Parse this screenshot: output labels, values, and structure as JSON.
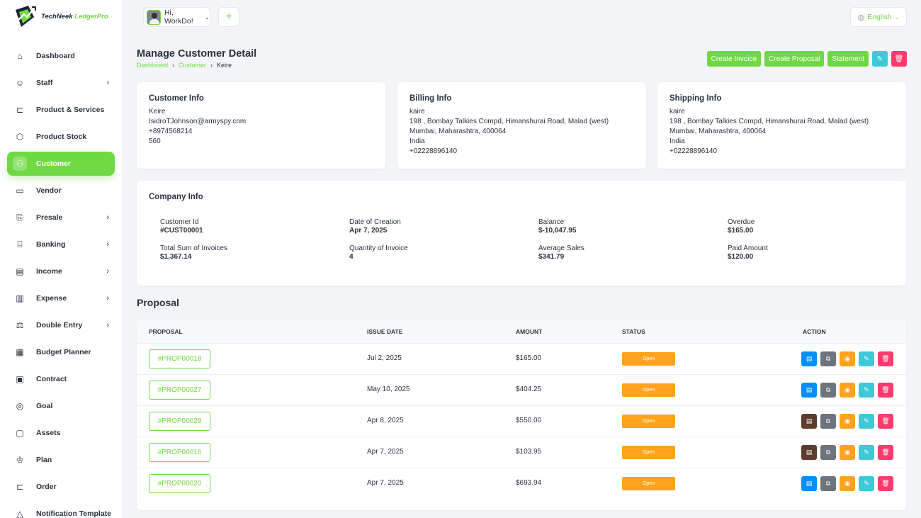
{
  "brand": {
    "name": "TechNeek",
    "accent": "LedgerPro",
    "accent_color": "#6fd943"
  },
  "sidebar": {
    "items": [
      {
        "label": "Dashboard",
        "icon": "home-icon",
        "glyph": "⌂",
        "chevron": false,
        "active": false
      },
      {
        "label": "Staff",
        "icon": "users-icon",
        "glyph": "☺",
        "chevron": true,
        "active": false
      },
      {
        "label": "Product & Services",
        "icon": "cart-icon",
        "glyph": "⊏",
        "chevron": false,
        "active": false
      },
      {
        "label": "Product Stock",
        "icon": "box-icon",
        "glyph": "⬡",
        "chevron": false,
        "active": false
      },
      {
        "label": "Customer",
        "icon": "user-plus-icon",
        "glyph": "⚇",
        "chevron": false,
        "active": true
      },
      {
        "label": "Vendor",
        "icon": "note-icon",
        "glyph": "▭",
        "chevron": false,
        "active": false
      },
      {
        "label": "Presale",
        "icon": "file-icon",
        "glyph": "⎘",
        "chevron": true,
        "active": false
      },
      {
        "label": "Banking",
        "icon": "bank-icon",
        "glyph": "⌸",
        "chevron": true,
        "active": false
      },
      {
        "label": "Income",
        "icon": "invoice-icon",
        "glyph": "▤",
        "chevron": true,
        "active": false
      },
      {
        "label": "Expense",
        "icon": "receipt-icon",
        "glyph": "▥",
        "chevron": true,
        "active": false
      },
      {
        "label": "Double Entry",
        "icon": "scale-icon",
        "glyph": "⚖",
        "chevron": true,
        "active": false
      },
      {
        "label": "Budget Planner",
        "icon": "budget-icon",
        "glyph": "▦",
        "chevron": false,
        "active": false
      },
      {
        "label": "Contract",
        "icon": "contract-icon",
        "glyph": "▣",
        "chevron": false,
        "active": false
      },
      {
        "label": "Goal",
        "icon": "target-icon",
        "glyph": "◎",
        "chevron": false,
        "active": false
      },
      {
        "label": "Assets",
        "icon": "calendar-icon",
        "glyph": "▢",
        "chevron": false,
        "active": false
      },
      {
        "label": "Plan",
        "icon": "trophy-icon",
        "glyph": "♔",
        "chevron": false,
        "active": false
      },
      {
        "label": "Order",
        "icon": "order-icon",
        "glyph": "⊏",
        "chevron": false,
        "active": false
      },
      {
        "label": "Notification Template",
        "icon": "bell-icon",
        "glyph": "△",
        "chevron": false,
        "active": false
      }
    ]
  },
  "header": {
    "greeting": "Hi, WorkDo!",
    "language": "English"
  },
  "page": {
    "title": "Manage Customer Detail",
    "breadcrumb": [
      "Dashboard",
      "Customer",
      "Keire"
    ],
    "actions": {
      "create_invoice": "Create Invoice",
      "create_proposal": "Create Proposal",
      "statement": "Statement"
    }
  },
  "customer_info": {
    "title": "Customer Info",
    "lines": [
      "Keire",
      "IsidroTJohnson@armyspy.com",
      "+8974568214",
      "560"
    ]
  },
  "billing_info": {
    "title": "Billing Info",
    "lines": [
      "kaire",
      "198 , Bombay Talkies Compd, Himanshurai Road, Malad (west)",
      "Mumbai, Maharashtra, 400064",
      "India",
      "+02228896140"
    ]
  },
  "shipping_info": {
    "title": "Shipping Info",
    "lines": [
      "kaire",
      "198 , Bombay Talkies Compd, Himanshurai Road, Malad (west)",
      "Mumbai, Maharashtra, 400064",
      "India",
      "+02228896140"
    ]
  },
  "company_info": {
    "title": "Company Info",
    "items": [
      {
        "label": "Customer Id",
        "value": "#CUST00001"
      },
      {
        "label": "Date of Creation",
        "value": "Apr 7, 2025"
      },
      {
        "label": "Balance",
        "value": "$-10,047.95"
      },
      {
        "label": "Overdue",
        "value": "$165.00"
      },
      {
        "label": "Total Sum of Invoices",
        "value": "$1,367.14"
      },
      {
        "label": "Quantity of Invoice",
        "value": "4"
      },
      {
        "label": "Average Sales",
        "value": "$341.79"
      },
      {
        "label": "Paid Amount",
        "value": "$120.00"
      }
    ]
  },
  "proposal": {
    "title": "Proposal",
    "columns": [
      "PROPOSAL",
      "ISSUE DATE",
      "AMOUNT",
      "STATUS",
      "ACTION"
    ],
    "rows": [
      {
        "id": "#PROP00018",
        "date": "Jul 2, 2025",
        "amount": "$165.00",
        "status": "Open",
        "first_action": "blue"
      },
      {
        "id": "#PROP00027",
        "date": "May 10, 2025",
        "amount": "$404.25",
        "status": "Open",
        "first_action": "blue"
      },
      {
        "id": "#PROP00028",
        "date": "Apr 8, 2025",
        "amount": "$550.00",
        "status": "Open",
        "first_action": "brown"
      },
      {
        "id": "#PROP00016",
        "date": "Apr 7, 2025",
        "amount": "$103.95",
        "status": "Open",
        "first_action": "brown"
      },
      {
        "id": "#PROP00020",
        "date": "Apr 7, 2025",
        "amount": "$693.94",
        "status": "Open",
        "first_action": "blue"
      }
    ]
  }
}
